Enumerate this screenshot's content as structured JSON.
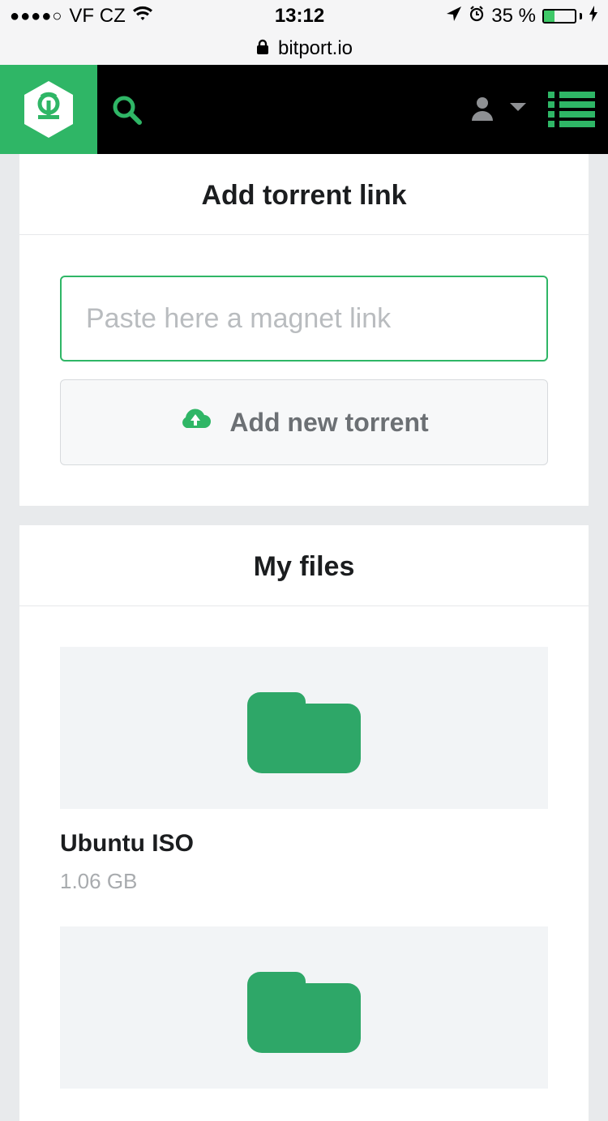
{
  "status_bar": {
    "signal_dots": "●●●●○",
    "carrier": "VF CZ",
    "time": "13:12",
    "battery_percent": "35 %"
  },
  "browser": {
    "domain": "bitport.io"
  },
  "add_section": {
    "title": "Add torrent link",
    "placeholder": "Paste here a magnet link",
    "button_label": "Add new torrent"
  },
  "files_section": {
    "title": "My files",
    "files": [
      {
        "name": "Ubuntu ISO",
        "size": "1.06 GB"
      },
      {
        "name": "",
        "size": ""
      }
    ]
  },
  "colors": {
    "brand_green": "#2fb666",
    "folder_green": "#34a269"
  }
}
